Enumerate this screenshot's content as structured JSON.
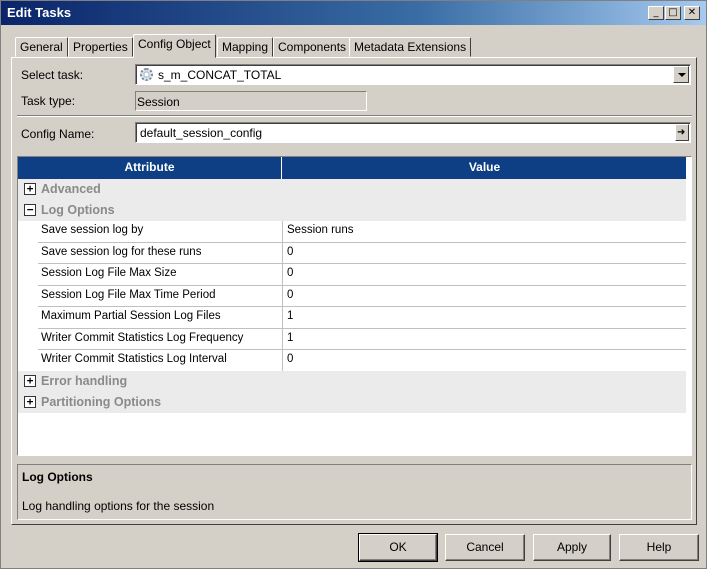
{
  "window": {
    "title": "Edit Tasks",
    "controls": {
      "minimize": "_",
      "maximize": "□",
      "close": "✕"
    }
  },
  "tabs": [
    {
      "label": "General"
    },
    {
      "label": "Properties"
    },
    {
      "label": "Config Object"
    },
    {
      "label": "Mapping"
    },
    {
      "label": "Components"
    },
    {
      "label": "Metadata Extensions"
    }
  ],
  "active_tab": "Config Object",
  "form": {
    "select_task_label": "Select task:",
    "select_task_value": "s_m_CONCAT_TOTAL",
    "task_type_label": "Task type:",
    "task_type_value": "Session",
    "config_name_label": "Config Name:",
    "config_name_value": "default_session_config"
  },
  "grid": {
    "headers": {
      "attribute": "Attribute",
      "value": "Value"
    },
    "groups": [
      {
        "name": "Advanced",
        "expanded": false
      },
      {
        "name": "Log Options",
        "expanded": true
      },
      {
        "name": "Error handling",
        "expanded": false
      },
      {
        "name": "Partitioning Options",
        "expanded": false
      }
    ],
    "expand_symbol": "+",
    "collapse_symbol": "−",
    "rows": [
      {
        "attribute": "Save session log by",
        "value": "Session runs"
      },
      {
        "attribute": "Save session log for these runs",
        "value": "0"
      },
      {
        "attribute": "Session Log File Max Size",
        "value": "0"
      },
      {
        "attribute": "Session Log File Max Time Period",
        "value": "0"
      },
      {
        "attribute": "Maximum Partial Session Log Files",
        "value": "1"
      },
      {
        "attribute": "Writer Commit Statistics Log Frequency",
        "value": "1"
      },
      {
        "attribute": "Writer Commit Statistics Log Interval",
        "value": "0"
      }
    ]
  },
  "description": {
    "title": "Log Options",
    "text": "Log handling options for the session"
  },
  "buttons": {
    "ok": "OK",
    "cancel": "Cancel",
    "apply": "Apply",
    "help": "Help"
  }
}
